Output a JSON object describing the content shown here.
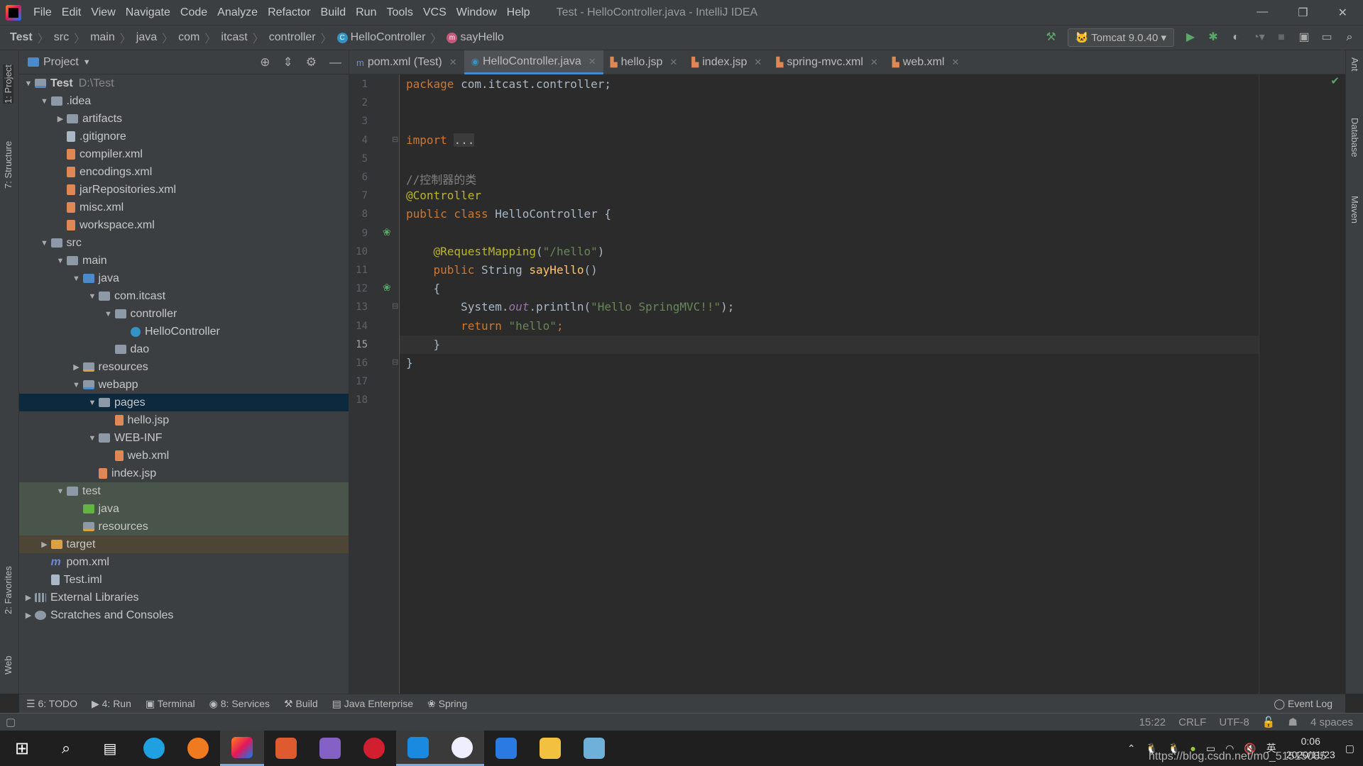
{
  "window": {
    "title": "Test - HelloController.java - IntelliJ IDEA",
    "min": "—",
    "restore": "❐",
    "close": "✕"
  },
  "menu": [
    "File",
    "Edit",
    "View",
    "Navigate",
    "Code",
    "Analyze",
    "Refactor",
    "Build",
    "Run",
    "Tools",
    "VCS",
    "Window",
    "Help"
  ],
  "breadcrumb": [
    "Test",
    "src",
    "main",
    "java",
    "com",
    "itcast",
    "controller",
    "HelloController",
    "sayHello"
  ],
  "run_config": "Tomcat 9.0.40",
  "left_strip": [
    "1: Project",
    "7: Structure",
    "2: Favorites",
    "Web"
  ],
  "right_strip": [
    "Ant",
    "Database",
    "Maven"
  ],
  "project": {
    "title": "Project",
    "tree": [
      {
        "d": 0,
        "ar": "open",
        "ic": "module",
        "l": "Test",
        "x": "D:\\Test",
        "bold": true
      },
      {
        "d": 1,
        "ar": "open",
        "ic": "folder",
        "l": ".idea"
      },
      {
        "d": 2,
        "ar": "closed",
        "ic": "folder",
        "l": "artifacts"
      },
      {
        "d": 2,
        "ar": "",
        "ic": "file",
        "l": ".gitignore"
      },
      {
        "d": 2,
        "ar": "",
        "ic": "xml",
        "l": "compiler.xml"
      },
      {
        "d": 2,
        "ar": "",
        "ic": "xml",
        "l": "encodings.xml"
      },
      {
        "d": 2,
        "ar": "",
        "ic": "xml",
        "l": "jarRepositories.xml"
      },
      {
        "d": 2,
        "ar": "",
        "ic": "xml",
        "l": "misc.xml"
      },
      {
        "d": 2,
        "ar": "",
        "ic": "xml",
        "l": "workspace.xml"
      },
      {
        "d": 1,
        "ar": "open",
        "ic": "folder",
        "l": "src"
      },
      {
        "d": 2,
        "ar": "open",
        "ic": "folder",
        "l": "main"
      },
      {
        "d": 3,
        "ar": "open",
        "ic": "src",
        "l": "java"
      },
      {
        "d": 4,
        "ar": "open",
        "ic": "pkg",
        "l": "com.itcast"
      },
      {
        "d": 5,
        "ar": "open",
        "ic": "pkg",
        "l": "controller"
      },
      {
        "d": 6,
        "ar": "",
        "ic": "cls",
        "l": "HelloController"
      },
      {
        "d": 5,
        "ar": "",
        "ic": "pkg",
        "l": "dao"
      },
      {
        "d": 3,
        "ar": "closed",
        "ic": "res",
        "l": "resources"
      },
      {
        "d": 3,
        "ar": "open",
        "ic": "module",
        "l": "webapp"
      },
      {
        "d": 4,
        "ar": "open",
        "ic": "folder",
        "l": "pages",
        "sel": true
      },
      {
        "d": 5,
        "ar": "",
        "ic": "jsp",
        "l": "hello.jsp"
      },
      {
        "d": 4,
        "ar": "open",
        "ic": "folder",
        "l": "WEB-INF"
      },
      {
        "d": 5,
        "ar": "",
        "ic": "xml",
        "l": "web.xml"
      },
      {
        "d": 4,
        "ar": "",
        "ic": "jsp",
        "l": "index.jsp"
      },
      {
        "d": 2,
        "ar": "open",
        "ic": "folder",
        "l": "test",
        "bg": "test"
      },
      {
        "d": 3,
        "ar": "",
        "ic": "tsrc",
        "l": "java",
        "bg": "test"
      },
      {
        "d": 3,
        "ar": "",
        "ic": "res",
        "l": "resources",
        "bg": "test"
      },
      {
        "d": 1,
        "ar": "closed",
        "ic": "excl",
        "l": "target",
        "bg": "excl"
      },
      {
        "d": 1,
        "ar": "",
        "ic": "mvn",
        "l": "pom.xml"
      },
      {
        "d": 1,
        "ar": "",
        "ic": "file",
        "l": "Test.iml"
      },
      {
        "d": 0,
        "ar": "closed",
        "ic": "lib",
        "l": "External Libraries"
      },
      {
        "d": 0,
        "ar": "closed",
        "ic": "scr",
        "l": "Scratches and Consoles"
      }
    ]
  },
  "tabs": [
    {
      "label": "pom.xml (Test)",
      "icon": "m"
    },
    {
      "label": "HelloController.java",
      "icon": "c",
      "active": true
    },
    {
      "label": "hello.jsp",
      "icon": "j"
    },
    {
      "label": "index.jsp",
      "icon": "j"
    },
    {
      "label": "spring-mvc.xml",
      "icon": "x"
    },
    {
      "label": "web.xml",
      "icon": "x"
    }
  ],
  "editor": {
    "current_line": 15,
    "lines": [
      [
        [
          "package ",
          "k"
        ],
        [
          "com.itcast.controller;",
          ""
        ]
      ],
      [],
      [],
      [
        [
          "import ",
          "k"
        ],
        [
          "...",
          "f"
        ]
      ],
      [],
      [
        [
          "//控制器的类",
          "c"
        ]
      ],
      [
        [
          "@Controller",
          "a"
        ]
      ],
      [
        [
          "public class ",
          "k"
        ],
        [
          "HelloController {",
          ""
        ]
      ],
      [],
      [
        [
          "    @RequestMapping",
          "a"
        ],
        [
          "(",
          ""
        ],
        [
          "\"/hello\"",
          "s"
        ],
        [
          ")",
          ""
        ]
      ],
      [
        [
          "    public ",
          "k"
        ],
        [
          "String ",
          ""
        ],
        [
          "sayHello",
          "m"
        ],
        [
          "()",
          ""
        ]
      ],
      [
        [
          "    {",
          ""
        ]
      ],
      [
        [
          "        System.",
          ""
        ],
        [
          "out",
          "st"
        ],
        [
          ".println(",
          ""
        ],
        [
          "\"Hello SpringMVC!!\"",
          "s"
        ],
        [
          ");",
          ""
        ]
      ],
      [
        [
          "        return ",
          "k"
        ],
        [
          "\"hello\"",
          "s"
        ],
        [
          ";",
          "k"
        ]
      ],
      [
        [
          "    }",
          ""
        ]
      ],
      [
        [
          "}",
          ""
        ]
      ],
      [],
      []
    ]
  },
  "bottom_tabs": [
    "6: TODO",
    "4: Run",
    "Terminal",
    "8: Services",
    "Build",
    "Java Enterprise",
    "Spring"
  ],
  "event_log": "Event Log",
  "status": {
    "position": "15:22",
    "line_sep": "CRLF",
    "encoding": "UTF-8",
    "indent": "4 spaces"
  },
  "taskbar": {
    "time": "0:06",
    "date": "2020/11/23",
    "ime": "英",
    "watermark": "https://blog.csdn.net/m0_51515085"
  },
  "colors": {
    "accent": "#4a88c7",
    "selection": "#0d293e"
  }
}
